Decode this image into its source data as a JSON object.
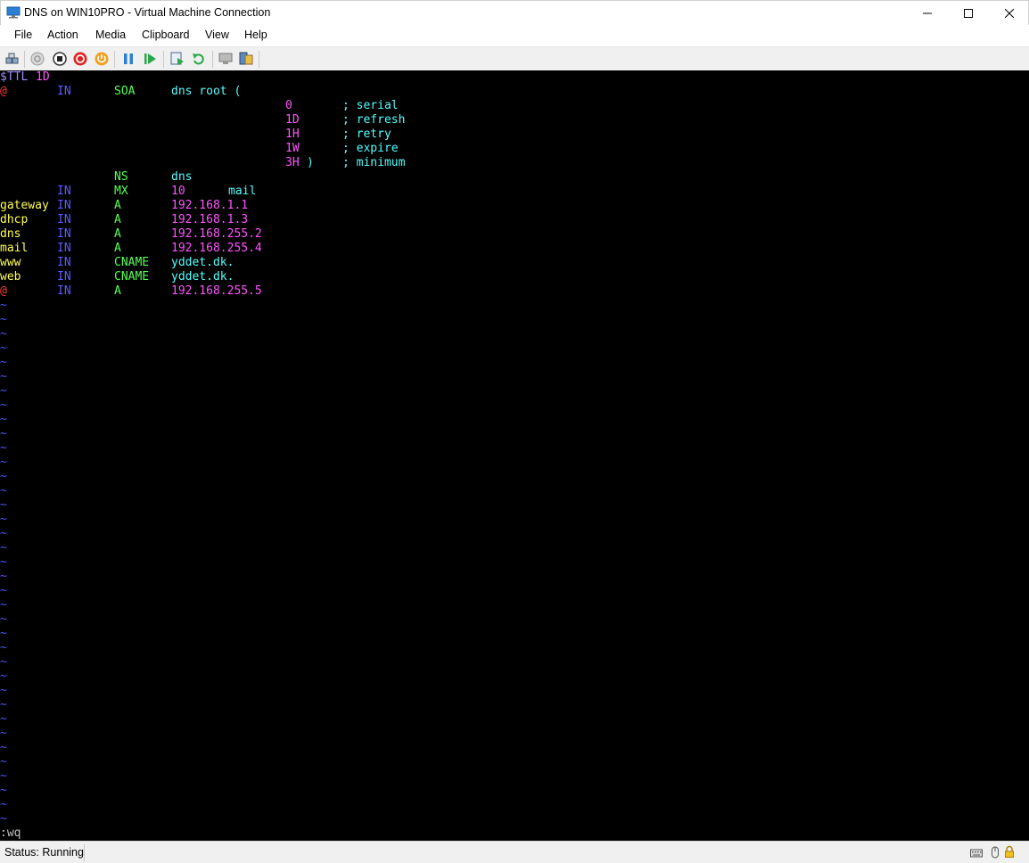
{
  "window": {
    "title": "DNS on WIN10PRO - Virtual Machine Connection",
    "minimize_glyph": "—",
    "maximize_glyph": "☐",
    "close_glyph": "✕"
  },
  "menu": {
    "items": [
      "File",
      "Action",
      "Media",
      "Clipboard",
      "View",
      "Help"
    ]
  },
  "toolbar": {
    "icons": [
      "ctrl-alt-del-icon",
      "start-icon",
      "turn-off-icon",
      "shut-down-icon",
      "power-icon",
      "pause-icon",
      "resume-icon",
      "checkpoint-icon",
      "revert-icon",
      "enhanced-session-icon",
      "share-icon"
    ]
  },
  "terminal": {
    "lines": [
      [
        {
          "t": "$TTL",
          "c": "purple",
          "col": 0
        },
        {
          "t": "1D",
          "c": "magenta",
          "col": 5
        }
      ],
      [
        {
          "t": "@",
          "c": "red",
          "col": 0
        },
        {
          "t": "IN",
          "c": "blue",
          "col": 8
        },
        {
          "t": "SOA",
          "c": "green",
          "col": 16
        },
        {
          "t": "dns root (",
          "c": "cyan",
          "col": 24
        }
      ],
      [
        {
          "t": "0",
          "c": "magenta",
          "col": 40
        },
        {
          "t": "; serial",
          "c": "cyan",
          "col": 48
        }
      ],
      [
        {
          "t": "1D",
          "c": "magenta",
          "col": 40
        },
        {
          "t": "; refresh",
          "c": "cyan",
          "col": 48
        }
      ],
      [
        {
          "t": "1H",
          "c": "magenta",
          "col": 40
        },
        {
          "t": "; retry",
          "c": "cyan",
          "col": 48
        }
      ],
      [
        {
          "t": "1W",
          "c": "magenta",
          "col": 40
        },
        {
          "t": "; expire",
          "c": "cyan",
          "col": 48
        }
      ],
      [
        {
          "t": "3H",
          "c": "magenta",
          "col": 40
        },
        {
          "t": ")",
          "c": "cyan",
          "col": 43
        },
        {
          "t": "; minimum",
          "c": "cyan",
          "col": 48
        }
      ],
      [
        {
          "t": "NS",
          "c": "green",
          "col": 16
        },
        {
          "t": "dns",
          "c": "cyan",
          "col": 24
        }
      ],
      [
        {
          "t": "IN",
          "c": "blue",
          "col": 8
        },
        {
          "t": "MX",
          "c": "green",
          "col": 16
        },
        {
          "t": "10",
          "c": "magenta",
          "col": 24
        },
        {
          "t": "mail",
          "c": "cyan",
          "col": 32
        }
      ],
      [
        {
          "t": "gateway",
          "c": "yellow",
          "col": 0
        },
        {
          "t": "IN",
          "c": "blue",
          "col": 8
        },
        {
          "t": "A",
          "c": "green",
          "col": 16
        },
        {
          "t": "192.168.1.1",
          "c": "magenta",
          "col": 24
        }
      ],
      [
        {
          "t": "dhcp",
          "c": "yellow",
          "col": 0
        },
        {
          "t": "IN",
          "c": "blue",
          "col": 8
        },
        {
          "t": "A",
          "c": "green",
          "col": 16
        },
        {
          "t": "192.168.1.3",
          "c": "magenta",
          "col": 24
        }
      ],
      [
        {
          "t": "dns",
          "c": "yellow",
          "col": 0
        },
        {
          "t": "IN",
          "c": "blue",
          "col": 8
        },
        {
          "t": "A",
          "c": "green",
          "col": 16
        },
        {
          "t": "192.168.255.2",
          "c": "magenta",
          "col": 24
        }
      ],
      [
        {
          "t": "mail",
          "c": "yellow",
          "col": 0
        },
        {
          "t": "IN",
          "c": "blue",
          "col": 8
        },
        {
          "t": "A",
          "c": "green",
          "col": 16
        },
        {
          "t": "192.168.255.4",
          "c": "magenta",
          "col": 24
        }
      ],
      [
        {
          "t": "www",
          "c": "yellow",
          "col": 0
        },
        {
          "t": "IN",
          "c": "blue",
          "col": 8
        },
        {
          "t": "CNAME",
          "c": "green",
          "col": 16
        },
        {
          "t": "yddet.dk.",
          "c": "cyan",
          "col": 24
        }
      ],
      [
        {
          "t": "web",
          "c": "yellow",
          "col": 0
        },
        {
          "t": "IN",
          "c": "blue",
          "col": 8
        },
        {
          "t": "CNAME",
          "c": "green",
          "col": 16
        },
        {
          "t": "yddet.dk.",
          "c": "cyan",
          "col": 24
        }
      ],
      [
        {
          "t": "@",
          "c": "red",
          "col": 0
        },
        {
          "t": "IN",
          "c": "blue",
          "col": 8
        },
        {
          "t": "A",
          "c": "green",
          "col": 16
        },
        {
          "t": "192.168.255.5",
          "c": "magenta",
          "col": 24
        }
      ]
    ],
    "tilde": "~",
    "tilde_count": 37,
    "command_line": ":wq"
  },
  "status": {
    "text": "Status: Running",
    "icons": [
      "keyboard-icon",
      "mouse-icon",
      "lock-icon"
    ]
  },
  "colors": {
    "terminal_bg": "#000000",
    "chrome_bg": "#f0f0f0"
  }
}
